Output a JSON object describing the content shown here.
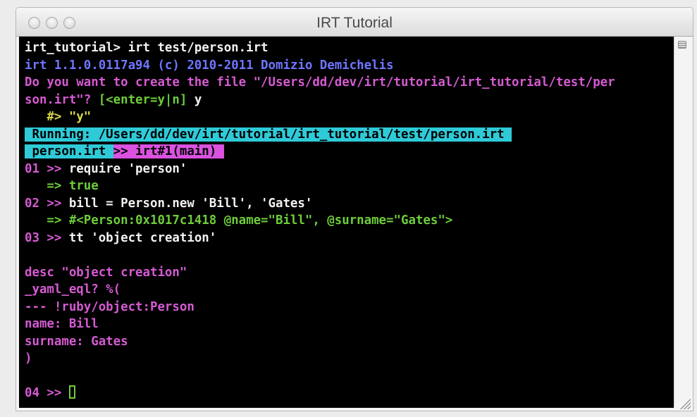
{
  "window": {
    "title": "IRT Tutorial"
  },
  "terminal": {
    "lines": [
      {
        "parts": [
          {
            "c": "w",
            "t": "irt_tutorial> irt test/person.irt"
          }
        ]
      },
      {
        "parts": [
          {
            "c": "b",
            "t": "irt 1.1.0.0117a94 (c) 2010-2011 Domizio Demichelis"
          }
        ]
      },
      {
        "parts": [
          {
            "c": "m",
            "t": "Do you want to create the file \"/Users/dd/dev/irt/tutorial/irt_tutorial/test/per"
          }
        ]
      },
      {
        "parts": [
          {
            "c": "m",
            "t": "son.irt\"? "
          },
          {
            "c": "g",
            "t": "[<enter=y|n]"
          },
          {
            "c": "w",
            "t": " y"
          }
        ]
      },
      {
        "parts": [
          {
            "c": "y",
            "t": "   #> \"y\""
          }
        ]
      },
      {
        "parts": [
          {
            "c": "bar-cyan",
            "t": " Running: /Users/dd/dev/irt/tutorial/irt_tutorial/test/person.irt "
          }
        ]
      },
      {
        "parts": [
          {
            "c": "bar-cyan",
            "t": " person.irt "
          },
          {
            "c": "bar-mag",
            "t": ">> irt#1(main) "
          }
        ]
      },
      {
        "parts": [
          {
            "c": "m",
            "t": "01 >> "
          },
          {
            "c": "w",
            "t": "require 'person'"
          }
        ]
      },
      {
        "parts": [
          {
            "c": "g",
            "t": "   => true"
          }
        ]
      },
      {
        "parts": [
          {
            "c": "m",
            "t": "02 >> "
          },
          {
            "c": "w",
            "t": "bill = Person.new 'Bill', 'Gates'"
          }
        ]
      },
      {
        "parts": [
          {
            "c": "g",
            "t": "   => #<Person:0x1017c1418 @name=\"Bill\", @surname=\"Gates\">"
          }
        ]
      },
      {
        "parts": [
          {
            "c": "m",
            "t": "03 >> "
          },
          {
            "c": "w",
            "t": "tt 'object creation'"
          }
        ]
      },
      {
        "parts": []
      },
      {
        "parts": [
          {
            "c": "m",
            "t": "desc \"object creation\""
          }
        ]
      },
      {
        "parts": [
          {
            "c": "m",
            "t": "_yaml_eql? %("
          }
        ]
      },
      {
        "parts": [
          {
            "c": "m",
            "t": "--- !ruby/object:Person"
          }
        ]
      },
      {
        "parts": [
          {
            "c": "m",
            "t": "name: Bill"
          }
        ]
      },
      {
        "parts": [
          {
            "c": "m",
            "t": "surname: Gates"
          }
        ]
      },
      {
        "parts": [
          {
            "c": "m",
            "t": ")"
          }
        ]
      },
      {
        "parts": []
      },
      {
        "parts": [
          {
            "c": "m",
            "t": "04 >> "
          }
        ],
        "cursor": true
      }
    ]
  }
}
